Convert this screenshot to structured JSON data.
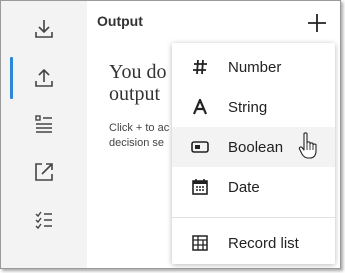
{
  "panel": {
    "title": "Output"
  },
  "empty_state": {
    "heading_line1": "You do",
    "heading_line2": "output",
    "body_line1": "Click + to ac",
    "body_line2": "decision se"
  },
  "rail": {
    "items": [
      {
        "icon": "download-icon"
      },
      {
        "icon": "upload-icon",
        "active": true
      },
      {
        "icon": "list-detail-icon"
      },
      {
        "icon": "open-external-icon"
      },
      {
        "icon": "checklist-icon"
      }
    ]
  },
  "menu": {
    "items": [
      {
        "label": "Number",
        "icon": "hash-icon"
      },
      {
        "label": "String",
        "icon": "letter-a-icon"
      },
      {
        "label": "Boolean",
        "icon": "toggle-icon",
        "hovered": true
      },
      {
        "label": "Date",
        "icon": "calendar-icon"
      },
      {
        "label": "Record list",
        "icon": "table-icon"
      }
    ]
  },
  "colors": {
    "accent": "#2b88d8",
    "icon": "#444444",
    "rail_bg": "#f3f3f3",
    "hover_bg": "#f3f3f3"
  }
}
